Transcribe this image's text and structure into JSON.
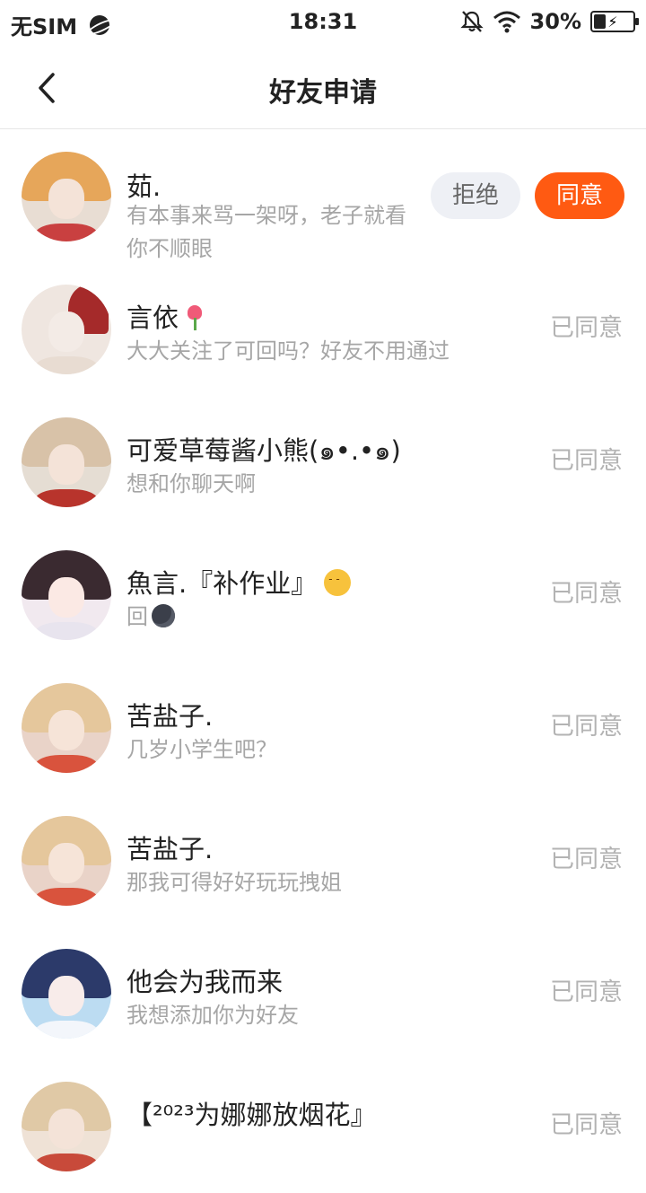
{
  "status_bar": {
    "carrier": "无SIM",
    "time": "18:31",
    "battery": "30%",
    "battery_level": 0.3
  },
  "header": {
    "title": "好友申请"
  },
  "actions": {
    "reject_label": "拒绝",
    "accept_label": "同意"
  },
  "requests": [
    {
      "name": "茹.",
      "message": "有本事来骂一架呀，老子就看你不顺眼",
      "status": ""
    },
    {
      "name": "言依",
      "message": "大大关注了可回吗？好友不用通过",
      "status": "已同意"
    },
    {
      "name": "可爱草莓酱小熊(๑•.•๑)",
      "message": "想和你聊天啊",
      "status": "已同意"
    },
    {
      "name": "魚言.『补作业』",
      "message": "回",
      "status": "已同意"
    },
    {
      "name": "苦盐子.",
      "message": "几岁小学生吧？",
      "status": "已同意"
    },
    {
      "name": "苦盐子.",
      "message": "那我可得好好玩玩拽姐",
      "status": "已同意"
    },
    {
      "name": "他会为我而来",
      "message": "我想添加你为好友",
      "status": "已同意"
    },
    {
      "name": "【²⁰²³为娜娜放烟花』",
      "message": "",
      "status": "已同意"
    }
  ],
  "colors": {
    "accent": "#ff5a12",
    "reject_bg": "#eef0f5",
    "muted_text": "#a6a6a6"
  },
  "icons": [
    "planet-icon",
    "mute-icon",
    "wifi-icon",
    "battery-icon",
    "back-icon",
    "tulip-emoji",
    "unamused-emoji",
    "new-moon-emoji"
  ]
}
